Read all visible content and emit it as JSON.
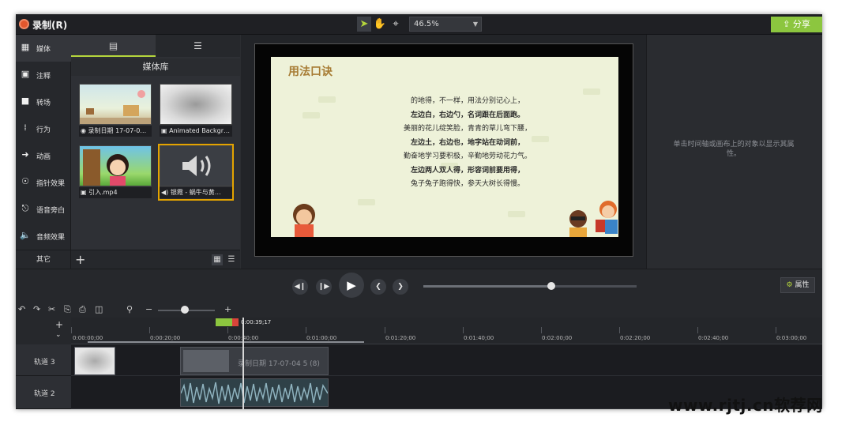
{
  "app": {
    "record_label": "录制(R)",
    "share_label": "分享",
    "zoom_value": "46.5%"
  },
  "sidebar": {
    "items": [
      {
        "label": "媒体"
      },
      {
        "label": "注释"
      },
      {
        "label": "转场"
      },
      {
        "label": "行为"
      },
      {
        "label": "动画"
      },
      {
        "label": "指针效果"
      },
      {
        "label": "语音旁白"
      },
      {
        "label": "音频效果"
      }
    ],
    "more_label": "其它"
  },
  "library": {
    "title": "媒体库",
    "items": [
      {
        "caption": "◉ 录制日期 17-07-0…"
      },
      {
        "caption": "▣ Animated Backgr…"
      },
      {
        "caption": "▣ 引入.mp4"
      },
      {
        "caption": "◀) 银霞 - 蜗牛与黄…"
      }
    ]
  },
  "canvas": {
    "slide_title": "用法口诀",
    "poem": [
      "的地得，不一样，用法分别记心上，",
      "左边白，右边勺，名词跟在后面跑。",
      "美丽的花儿绽笑脸，青青的草儿弯下腰，",
      "左边土，右边也，地字站在动词前，",
      "勤奋地学习要积极，辛勤地劳动花力气。",
      "左边两人双人得，形容词前要用得，",
      "兔子兔子跑得快，参天大树长得慢。"
    ]
  },
  "properties": {
    "empty_message": "单击时间轴或画布上的对象以显示其属性。",
    "button_label": "属性"
  },
  "playback": {
    "progress": 0.6
  },
  "timeline": {
    "playhead_time": "0:00:39;17",
    "ticks": [
      "0:00:00;00",
      "0:00:20;00",
      "0:00:40;00",
      "0:01:00;00",
      "0:01:20;00",
      "0:01:40;00",
      "0:02:00;00",
      "0:02:20;00",
      "0:02:40;00",
      "0:03:00;00"
    ],
    "tracks": [
      {
        "label": "轨道 3",
        "clip_label": "录制日期 17-07-04 5 (8)"
      },
      {
        "label": "轨道 2"
      }
    ]
  },
  "watermark": "www.rjtj.cn软荐网",
  "colors": {
    "accent": "#8cc63f",
    "selection": "#e3a300",
    "record": "#e2572d"
  }
}
